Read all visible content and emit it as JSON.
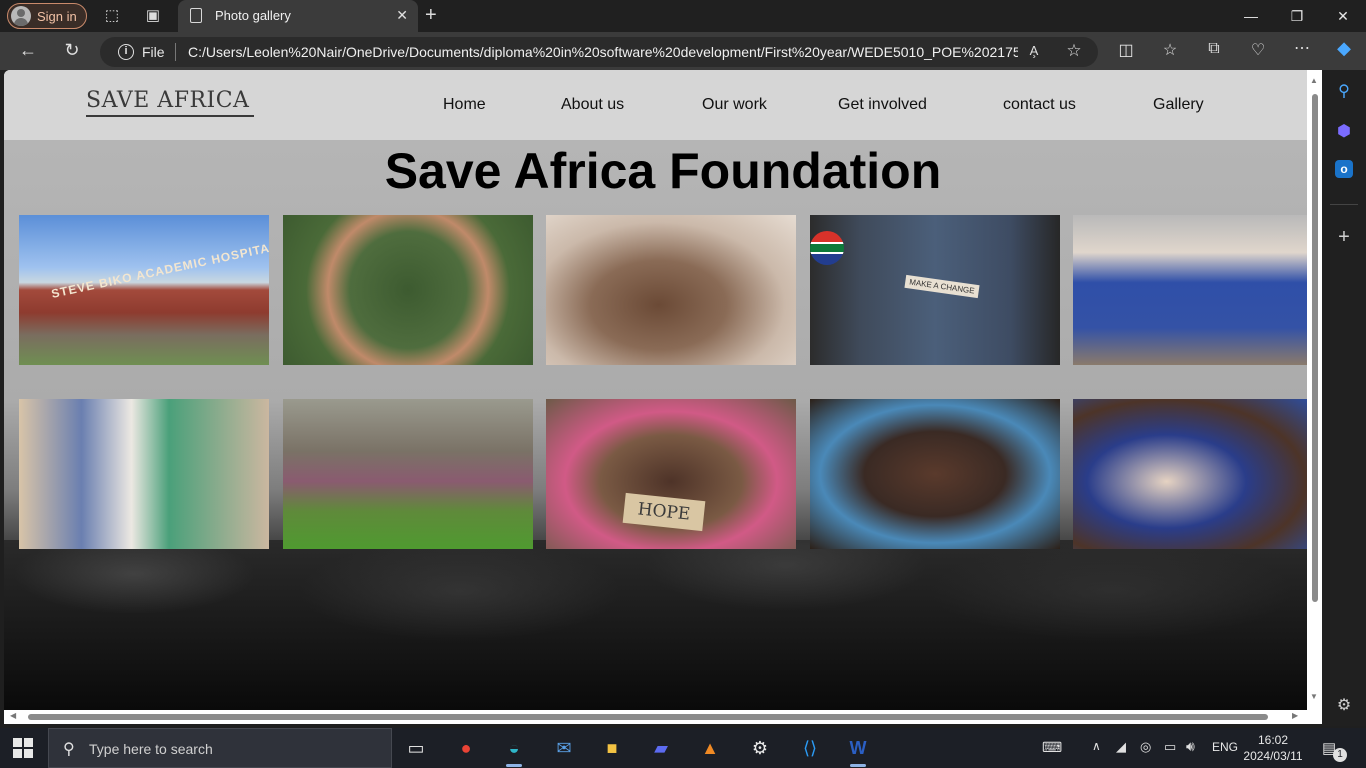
{
  "browser": {
    "signin_label": "Sign in",
    "tab_title": "Photo gallery",
    "address_prefix": "File",
    "url": "C:/Users/Leolen%20Nair/OneDrive/Documents/diploma%20in%20software%20development/First%20year/WEDE5010_POE%202175..."
  },
  "site": {
    "logo_text": "SAVE AFRICA",
    "nav": [
      "Home",
      "About us",
      "Our work",
      "Get involved",
      "contact us",
      "Gallery"
    ],
    "heading": "Save Africa Foundation",
    "photo_text": {
      "hospital_sign": "STEVE BIKO ACADEMIC HOSPITAL",
      "coin_note": "MAKE A CHANGE",
      "hope_sign": "HOPE"
    }
  },
  "taskbar": {
    "search_placeholder": "Type here to search",
    "language": "ENG",
    "time": "16:02",
    "date": "2024/03/11",
    "notification_count": "1"
  },
  "colors": {
    "header_bg": "#d6d6d6",
    "page_bg_top": "#b8b8b8",
    "taskbar_bg": "#1c1f26",
    "browser_chrome": "#202020"
  }
}
